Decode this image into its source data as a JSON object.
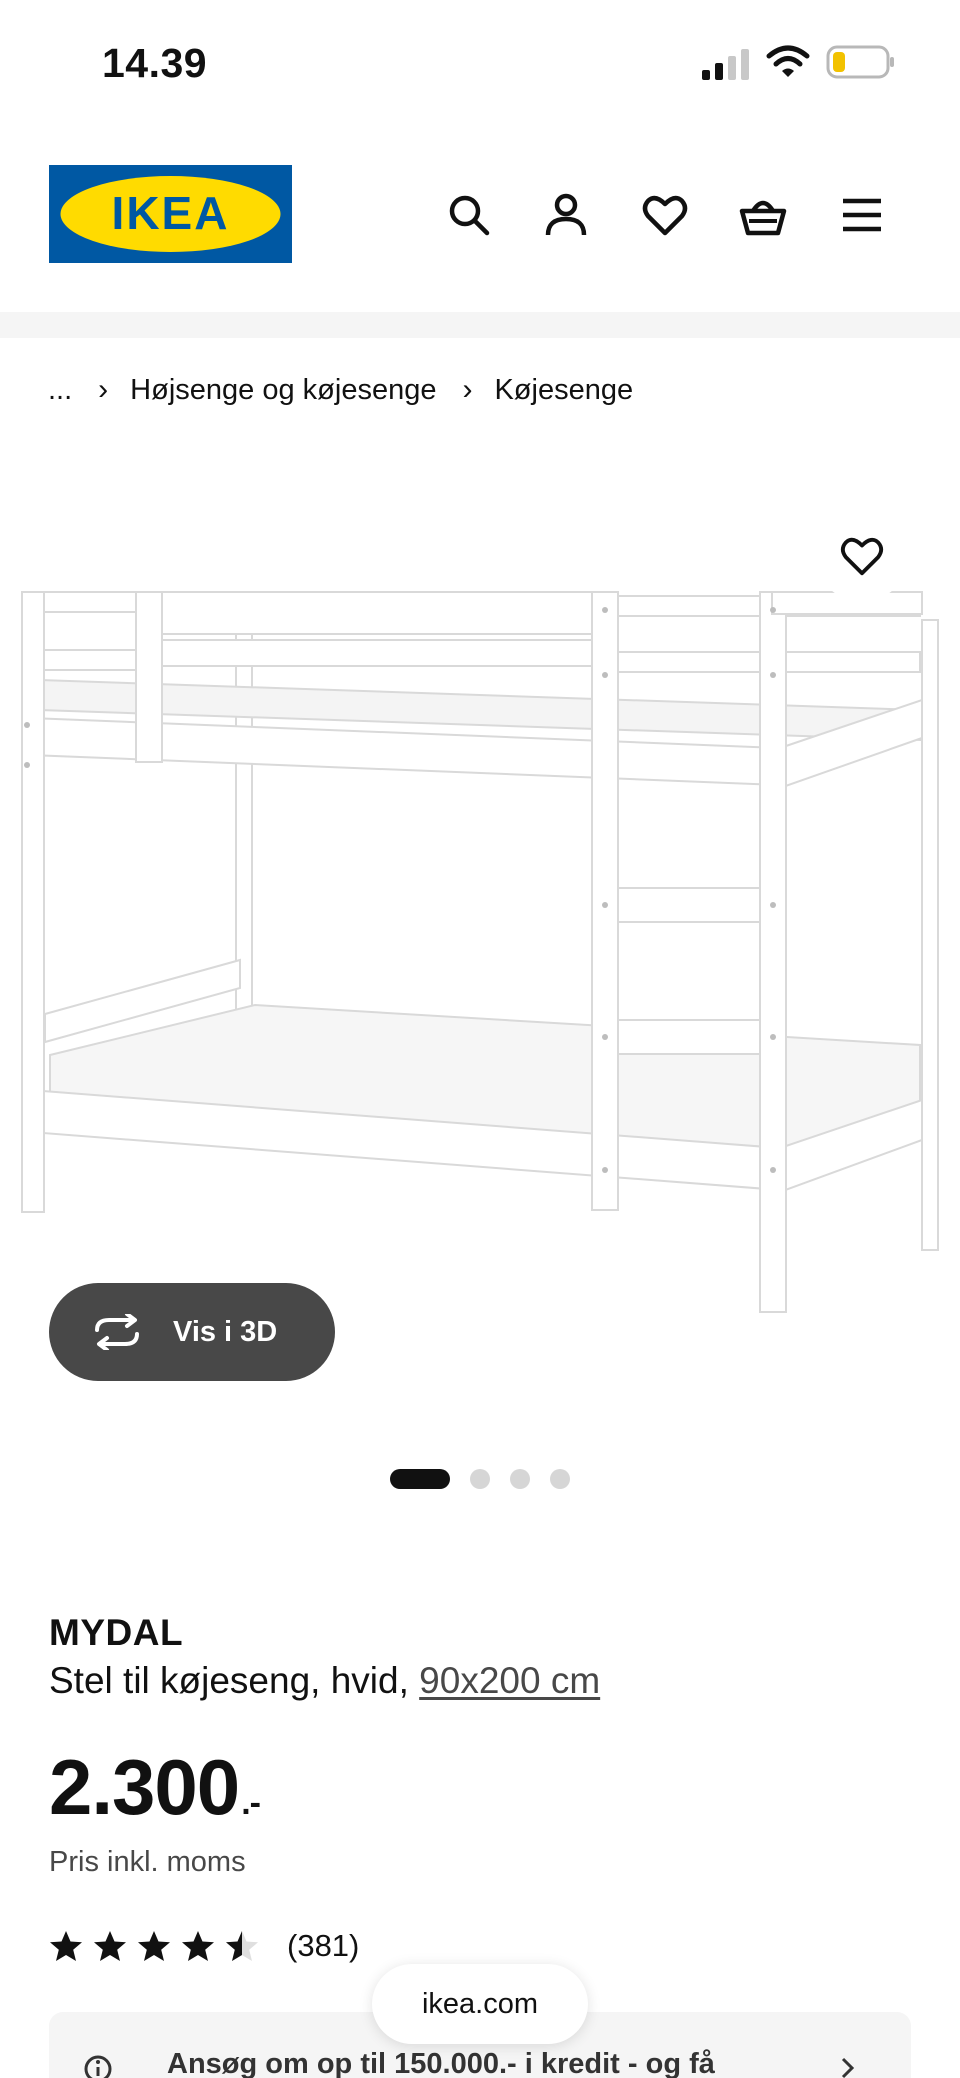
{
  "status_bar": {
    "time": "14.39",
    "icons": [
      "signal-icon",
      "wifi-icon",
      "battery-icon"
    ]
  },
  "header": {
    "logo_text": "IKEA",
    "brand_colors": {
      "blue": "#0058a3",
      "yellow": "#ffdb00"
    },
    "icons": [
      "search-icon",
      "account-icon",
      "heart-icon",
      "basket-icon",
      "menu-icon"
    ]
  },
  "breadcrumb": {
    "ellipsis": "...",
    "separator": "›",
    "items": [
      "Højsenge og køjesenge",
      "Køjesenge"
    ]
  },
  "gallery": {
    "view_3d_label": "Vis i 3D",
    "image_count": 4,
    "active_index": 0
  },
  "product": {
    "name": "MYDAL",
    "description": "Stel til køjeseng, hvid,",
    "size": "90x200 cm",
    "price": "2.300",
    "price_suffix": ".-",
    "price_note": "Pris inkl. moms",
    "rating_value": 4.5,
    "rating_count": "(381)"
  },
  "credit_banner": {
    "text": "Ansøg om op til 150.000.- i kredit - og få"
  },
  "browser": {
    "url": "ikea.com"
  }
}
